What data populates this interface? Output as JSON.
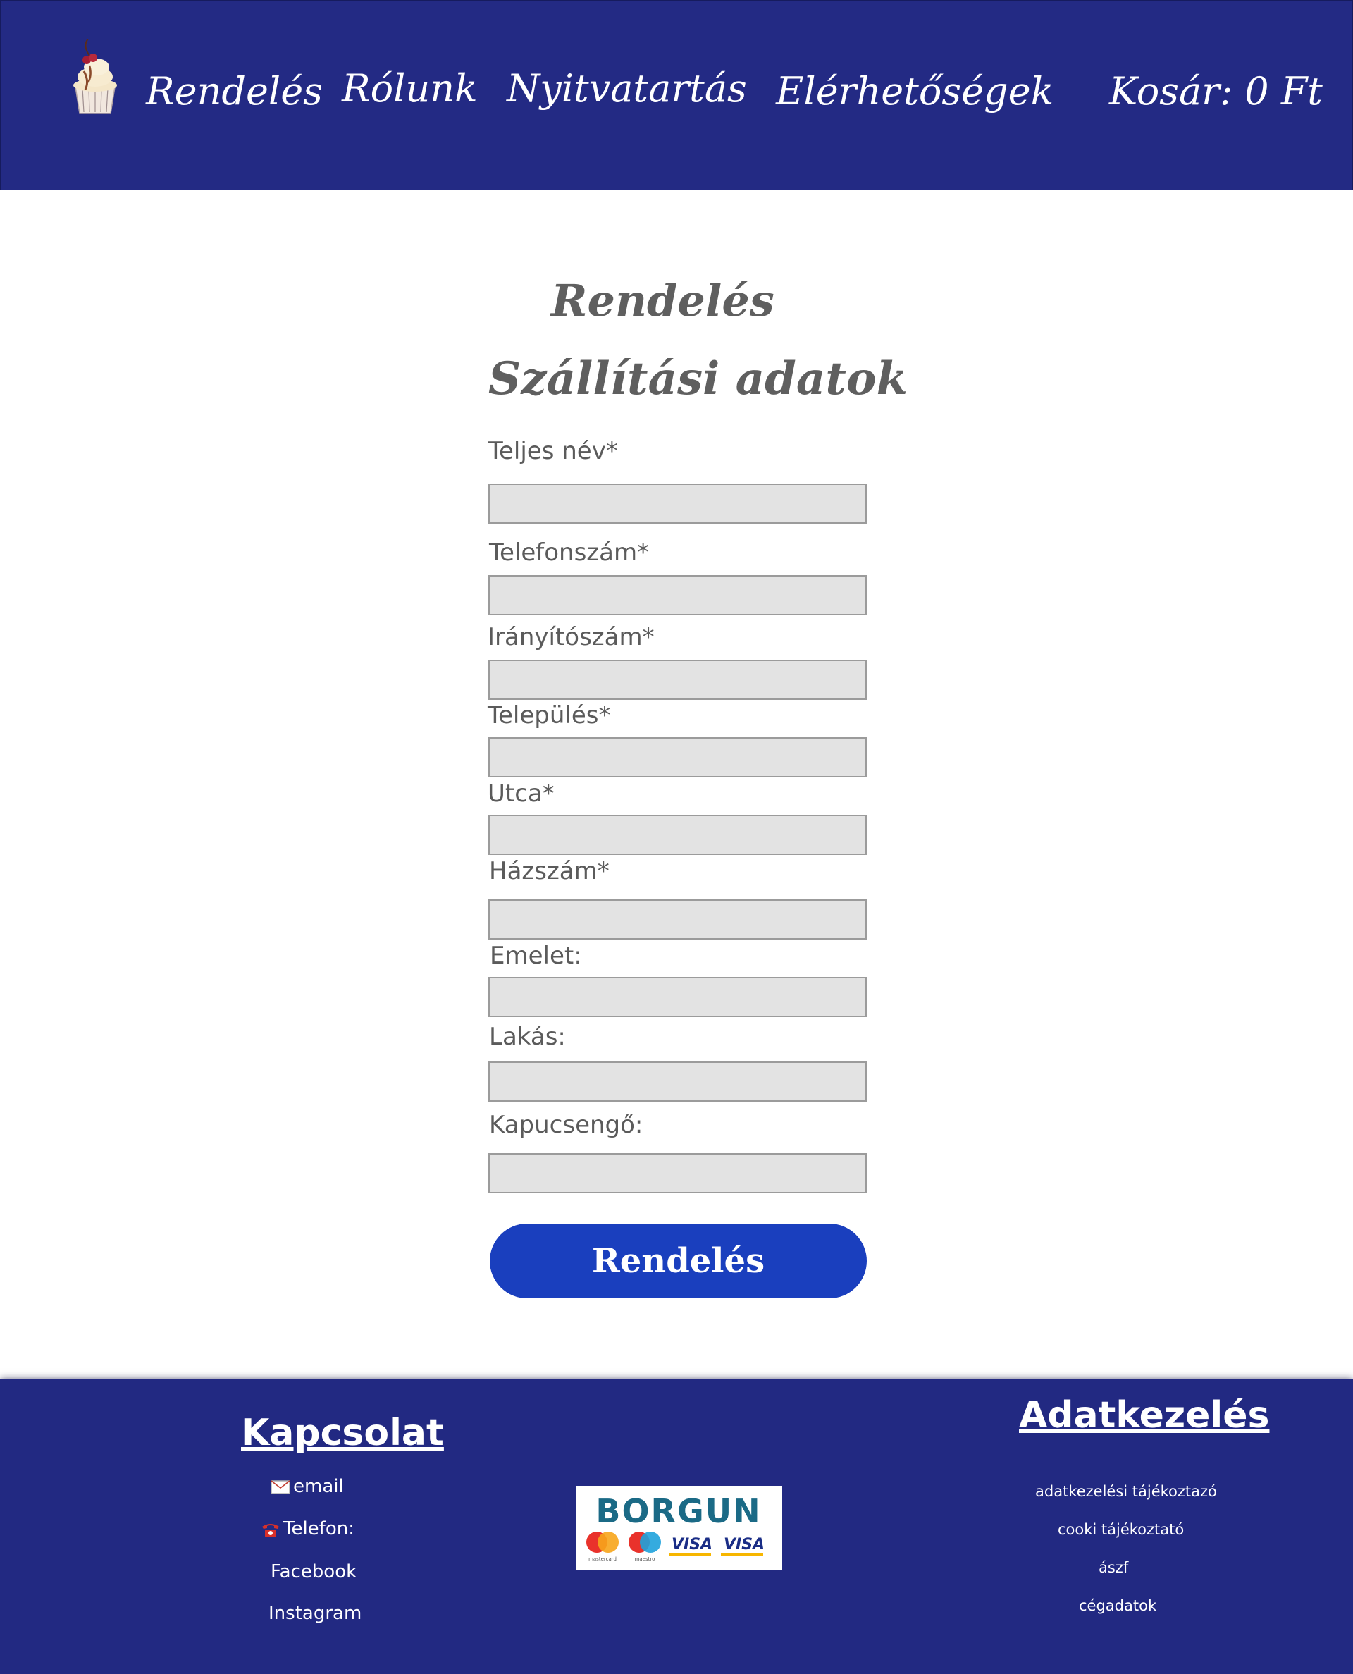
{
  "header": {
    "logo_icon": "cupcake-logo-icon",
    "nav": {
      "order": "Rendelés",
      "about": "Rólunk",
      "hours": "Nyitvatartás",
      "contact": "Elérhetőségek",
      "cart": "Kosár: 0 Ft"
    }
  },
  "main": {
    "page_title": "Rendelés",
    "section_title": "Szállítási adatok",
    "fields": {
      "full_name": {
        "label": "Teljes név*",
        "value": ""
      },
      "phone": {
        "label": "Telefonszám*",
        "value": ""
      },
      "zip": {
        "label": "Irányítószám*",
        "value": ""
      },
      "city": {
        "label": "Település*",
        "value": ""
      },
      "street": {
        "label": "Utca*",
        "value": ""
      },
      "house_number": {
        "label": "Házszám*",
        "value": ""
      },
      "floor": {
        "label": "Emelet:",
        "value": ""
      },
      "apartment": {
        "label": "Lakás:",
        "value": ""
      },
      "doorbell": {
        "label": "Kapucsengő:",
        "value": ""
      }
    },
    "submit_label": "Rendelés"
  },
  "footer": {
    "contact": {
      "heading": "Kapcsolat",
      "email": "email",
      "phone": "Telefon:",
      "facebook": "Facebook",
      "instagram": "Instagram"
    },
    "payment_logo": {
      "brand": "BORGUN",
      "card_marks": [
        "mastercard",
        "maestro",
        "VISA",
        "VISA"
      ]
    },
    "privacy": {
      "heading": "Adatkezelés",
      "links": [
        "adatkezelési tájékoztazó",
        "cooki tájékoztató",
        "ászf",
        "cégadatok"
      ]
    }
  },
  "colors": {
    "header_bg": "#232a84",
    "footer_bg": "#222982",
    "button_bg": "#1a3fbe",
    "input_bg": "#e3e3e3",
    "text_gray": "#5f5f5f",
    "borgun_teal": "#1b6a86"
  }
}
